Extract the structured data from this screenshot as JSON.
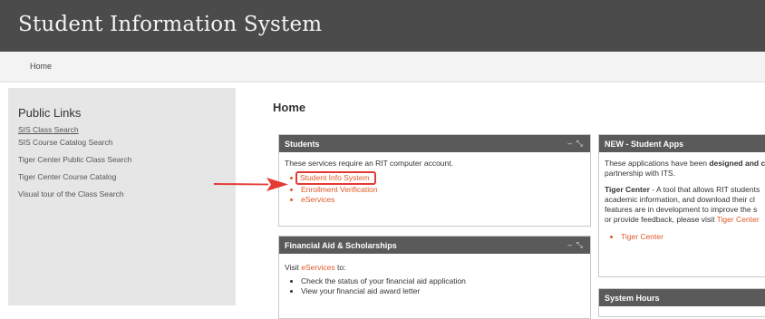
{
  "app": {
    "title": "Student Information System"
  },
  "nav": {
    "home": "Home"
  },
  "sidebar": {
    "heading": "Public Links",
    "links": [
      "SIS Class Search",
      "SIS Course Catalog Search",
      "Tiger Center Public Class Search",
      "Tiger Center Course Catalog",
      "Visual tour of the Class Search"
    ]
  },
  "main": {
    "title": "Home"
  },
  "students_panel": {
    "title": "Students",
    "controls": "– ⤡",
    "intro": "These services require an RIT computer account.",
    "links": [
      "Student Info System",
      "Enrollment Verification",
      "eServices"
    ]
  },
  "financial_panel": {
    "title": "Financial Aid & Scholarships",
    "controls": "– ⤡",
    "visit_link": "eServices",
    "visit_prefix": "Visit ",
    "visit_suffix": " to:",
    "items": [
      "Check the status of your financial aid application",
      "View your financial aid award letter"
    ]
  },
  "apps_panel": {
    "title": "NEW - Student Apps",
    "line1_prefix": "These applications have been ",
    "line1_bold": "designed and c",
    "line2": "partnership with ITS.",
    "tc_bold": "Tiger Center",
    "tc_text": " - A tool that allows RIT students",
    "tc_line2": "academic information, and download their cl",
    "tc_line3": "features are in development to improve the s",
    "tc_line4_prefix": "or provide feedback, please visit ",
    "tc_line4_link": "Tiger Center",
    "links": [
      "Tiger Center"
    ]
  },
  "hours_panel": {
    "title": "System Hours"
  },
  "colors": {
    "header": "#4b4b4b",
    "panel_header": "#5a5a5a",
    "link": "#e0592a",
    "highlight": "#e53935"
  }
}
